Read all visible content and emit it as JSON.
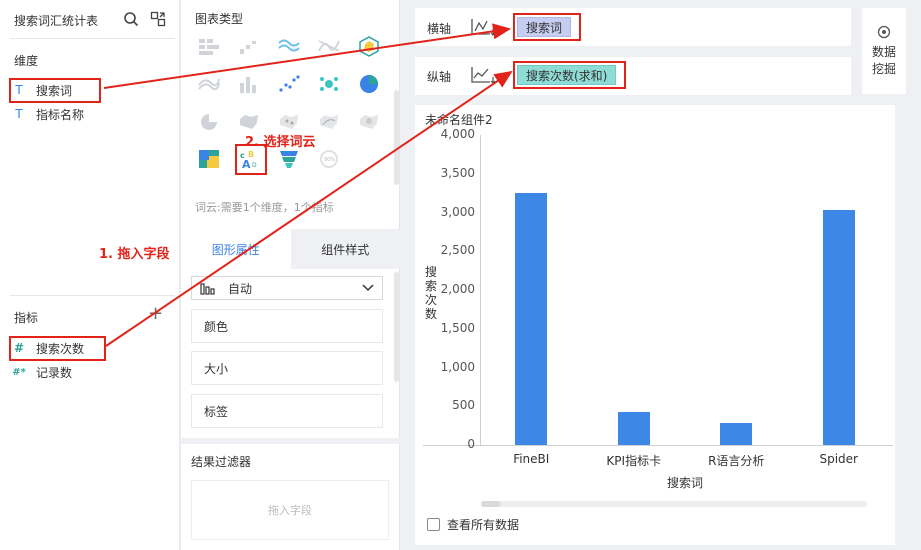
{
  "left": {
    "title": "搜索词汇统计表",
    "dim_title": "维度",
    "dimensions": [
      {
        "label": "搜索词",
        "type": "T"
      },
      {
        "label": "指标名称",
        "type": "T"
      }
    ],
    "measure_title": "指标",
    "add_symbol": "+",
    "measures": [
      {
        "label": "搜索次数",
        "type": "#"
      },
      {
        "label": "记录数",
        "type": "#*"
      }
    ]
  },
  "mid": {
    "title": "图表类型",
    "hint": "词云:需要1个维度，1个指标",
    "tabs": [
      "图形属性",
      "组件样式"
    ],
    "auto_label": "自动",
    "props": [
      "颜色",
      "大小",
      "标签"
    ],
    "filter_title": "结果过滤器",
    "drop_placeholder": "拖入字段"
  },
  "axes": {
    "x_label": "横轴",
    "x_field": "搜索词",
    "y_label": "纵轴",
    "y_field": "搜索次数(求和)",
    "mining_line1": "数据",
    "mining_line2": "挖掘"
  },
  "annotations": {
    "step1": "1. 拖入字段",
    "step2": "2. 选择词云"
  },
  "chart_panel": {
    "name": "未命名组件2",
    "view_all": "查看所有数据"
  },
  "colors": {
    "accent": "#3a83e6",
    "bar": "#3d87e6",
    "highlight": "#e2231a",
    "pill_x": "#c5cdf0",
    "pill_y": "#8fdcd6"
  },
  "chart_data": {
    "type": "bar",
    "categories": [
      "FineBI",
      "KPI指标卡",
      "R语言分析",
      "Spider"
    ],
    "values": [
      3250,
      420,
      290,
      3030
    ],
    "xlabel": "搜索词",
    "ylabel": "搜索次数",
    "ylim": [
      0,
      4000
    ],
    "yticks": [
      "4,000",
      "3,500",
      "3,000",
      "2,500",
      "2,000",
      "1,500",
      "1,000",
      "500",
      "0"
    ],
    "grid": false
  }
}
